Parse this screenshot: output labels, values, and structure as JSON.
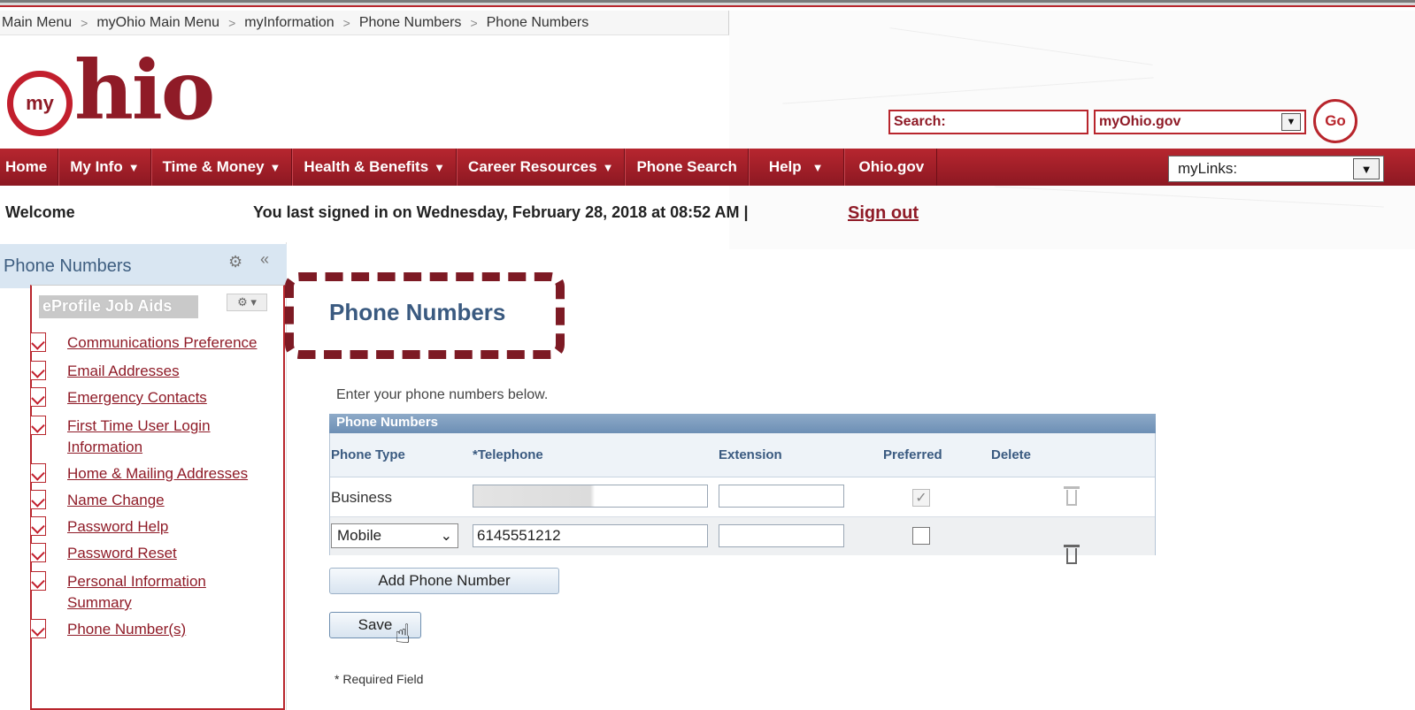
{
  "breadcrumb": {
    "items": [
      "Main Menu",
      "myOhio Main Menu",
      "myInformation",
      "Phone Numbers",
      "Phone Numbers"
    ],
    "separator": ">"
  },
  "logo": {
    "badge": "my",
    "text": "hio"
  },
  "search": {
    "label": "Search:",
    "scope_value": "myOhio.gov",
    "go_label": "Go"
  },
  "nav": {
    "items": [
      {
        "label": "Home",
        "dropdown": false
      },
      {
        "label": "My Info",
        "dropdown": true
      },
      {
        "label": "Time & Money",
        "dropdown": true
      },
      {
        "label": "Health & Benefits",
        "dropdown": true
      },
      {
        "label": "Career Resources",
        "dropdown": true
      },
      {
        "label": "Phone Search",
        "dropdown": false
      },
      {
        "label": "Help",
        "dropdown": true
      },
      {
        "label": "Ohio.gov",
        "dropdown": false
      }
    ],
    "dropdown_glyph": "▼",
    "mylinks_value": "myLinks:"
  },
  "welcome": {
    "label": "Welcome",
    "last_signed": "You last signed in on Wednesday, February 28, 2018 at 08:52 AM  |",
    "sign_out": "Sign out"
  },
  "left_panel": {
    "title": "Phone Numbers",
    "gear_glyph": "⚙",
    "collapse_glyph": "«",
    "job_aids_title": "eProfile Job Aids",
    "job_aids_menu_glyph": "⚙ ▾",
    "links": [
      "Communications Preference",
      "Email Addresses",
      "Emergency Contacts",
      "First Time User Login Information",
      "Home & Mailing Addresses",
      "Name Change",
      "Password Help",
      "Password Reset",
      "Personal Information Summary",
      "Phone Number(s)"
    ]
  },
  "main": {
    "page_title": "Phone Numbers",
    "instructions": "Enter your phone numbers below.",
    "grid": {
      "caption": "Phone Numbers",
      "columns": [
        "Phone Type",
        "*Telephone",
        "Extension",
        "Preferred",
        "Delete"
      ],
      "rows": [
        {
          "phone_type": "Business",
          "telephone": "",
          "extension": "",
          "preferred": true,
          "editable_type": false
        },
        {
          "phone_type": "Mobile",
          "telephone": "6145551212",
          "extension": "",
          "preferred": false,
          "editable_type": true
        }
      ],
      "check_glyph": "✓",
      "select_chevron": "⌄"
    },
    "add_button": "Add Phone Number",
    "save_button": "Save",
    "required_note": "* Required Field"
  },
  "colors": {
    "brand_red": "#b8252c",
    "brand_dark_red": "#8f1b27",
    "heading_blue": "#3a5a80",
    "grid_caption": "#7b9cc0"
  },
  "icons": {
    "pdf": "pdf-icon",
    "trash": "trash-icon",
    "cursor": "hand-pointer-icon"
  }
}
